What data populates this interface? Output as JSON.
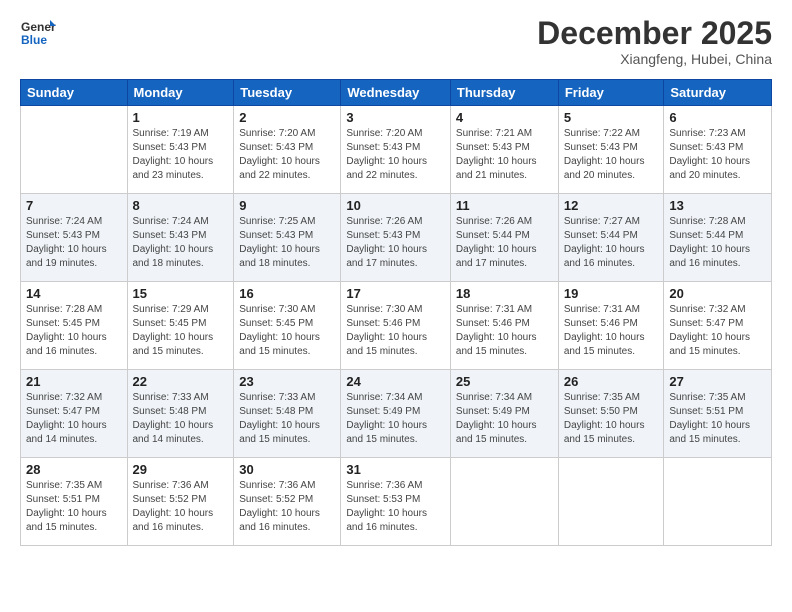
{
  "header": {
    "logo_line1": "General",
    "logo_line2": "Blue",
    "month_title": "December 2025",
    "location": "Xiangfeng, Hubei, China"
  },
  "weekdays": [
    "Sunday",
    "Monday",
    "Tuesday",
    "Wednesday",
    "Thursday",
    "Friday",
    "Saturday"
  ],
  "weeks": [
    [
      {
        "day": "",
        "info": ""
      },
      {
        "day": "1",
        "info": "Sunrise: 7:19 AM\nSunset: 5:43 PM\nDaylight: 10 hours\nand 23 minutes."
      },
      {
        "day": "2",
        "info": "Sunrise: 7:20 AM\nSunset: 5:43 PM\nDaylight: 10 hours\nand 22 minutes."
      },
      {
        "day": "3",
        "info": "Sunrise: 7:20 AM\nSunset: 5:43 PM\nDaylight: 10 hours\nand 22 minutes."
      },
      {
        "day": "4",
        "info": "Sunrise: 7:21 AM\nSunset: 5:43 PM\nDaylight: 10 hours\nand 21 minutes."
      },
      {
        "day": "5",
        "info": "Sunrise: 7:22 AM\nSunset: 5:43 PM\nDaylight: 10 hours\nand 20 minutes."
      },
      {
        "day": "6",
        "info": "Sunrise: 7:23 AM\nSunset: 5:43 PM\nDaylight: 10 hours\nand 20 minutes."
      }
    ],
    [
      {
        "day": "7",
        "info": "Sunrise: 7:24 AM\nSunset: 5:43 PM\nDaylight: 10 hours\nand 19 minutes."
      },
      {
        "day": "8",
        "info": "Sunrise: 7:24 AM\nSunset: 5:43 PM\nDaylight: 10 hours\nand 18 minutes."
      },
      {
        "day": "9",
        "info": "Sunrise: 7:25 AM\nSunset: 5:43 PM\nDaylight: 10 hours\nand 18 minutes."
      },
      {
        "day": "10",
        "info": "Sunrise: 7:26 AM\nSunset: 5:43 PM\nDaylight: 10 hours\nand 17 minutes."
      },
      {
        "day": "11",
        "info": "Sunrise: 7:26 AM\nSunset: 5:44 PM\nDaylight: 10 hours\nand 17 minutes."
      },
      {
        "day": "12",
        "info": "Sunrise: 7:27 AM\nSunset: 5:44 PM\nDaylight: 10 hours\nand 16 minutes."
      },
      {
        "day": "13",
        "info": "Sunrise: 7:28 AM\nSunset: 5:44 PM\nDaylight: 10 hours\nand 16 minutes."
      }
    ],
    [
      {
        "day": "14",
        "info": "Sunrise: 7:28 AM\nSunset: 5:45 PM\nDaylight: 10 hours\nand 16 minutes."
      },
      {
        "day": "15",
        "info": "Sunrise: 7:29 AM\nSunset: 5:45 PM\nDaylight: 10 hours\nand 15 minutes."
      },
      {
        "day": "16",
        "info": "Sunrise: 7:30 AM\nSunset: 5:45 PM\nDaylight: 10 hours\nand 15 minutes."
      },
      {
        "day": "17",
        "info": "Sunrise: 7:30 AM\nSunset: 5:46 PM\nDaylight: 10 hours\nand 15 minutes."
      },
      {
        "day": "18",
        "info": "Sunrise: 7:31 AM\nSunset: 5:46 PM\nDaylight: 10 hours\nand 15 minutes."
      },
      {
        "day": "19",
        "info": "Sunrise: 7:31 AM\nSunset: 5:46 PM\nDaylight: 10 hours\nand 15 minutes."
      },
      {
        "day": "20",
        "info": "Sunrise: 7:32 AM\nSunset: 5:47 PM\nDaylight: 10 hours\nand 15 minutes."
      }
    ],
    [
      {
        "day": "21",
        "info": "Sunrise: 7:32 AM\nSunset: 5:47 PM\nDaylight: 10 hours\nand 14 minutes."
      },
      {
        "day": "22",
        "info": "Sunrise: 7:33 AM\nSunset: 5:48 PM\nDaylight: 10 hours\nand 14 minutes."
      },
      {
        "day": "23",
        "info": "Sunrise: 7:33 AM\nSunset: 5:48 PM\nDaylight: 10 hours\nand 15 minutes."
      },
      {
        "day": "24",
        "info": "Sunrise: 7:34 AM\nSunset: 5:49 PM\nDaylight: 10 hours\nand 15 minutes."
      },
      {
        "day": "25",
        "info": "Sunrise: 7:34 AM\nSunset: 5:49 PM\nDaylight: 10 hours\nand 15 minutes."
      },
      {
        "day": "26",
        "info": "Sunrise: 7:35 AM\nSunset: 5:50 PM\nDaylight: 10 hours\nand 15 minutes."
      },
      {
        "day": "27",
        "info": "Sunrise: 7:35 AM\nSunset: 5:51 PM\nDaylight: 10 hours\nand 15 minutes."
      }
    ],
    [
      {
        "day": "28",
        "info": "Sunrise: 7:35 AM\nSunset: 5:51 PM\nDaylight: 10 hours\nand 15 minutes."
      },
      {
        "day": "29",
        "info": "Sunrise: 7:36 AM\nSunset: 5:52 PM\nDaylight: 10 hours\nand 16 minutes."
      },
      {
        "day": "30",
        "info": "Sunrise: 7:36 AM\nSunset: 5:52 PM\nDaylight: 10 hours\nand 16 minutes."
      },
      {
        "day": "31",
        "info": "Sunrise: 7:36 AM\nSunset: 5:53 PM\nDaylight: 10 hours\nand 16 minutes."
      },
      {
        "day": "",
        "info": ""
      },
      {
        "day": "",
        "info": ""
      },
      {
        "day": "",
        "info": ""
      }
    ]
  ]
}
